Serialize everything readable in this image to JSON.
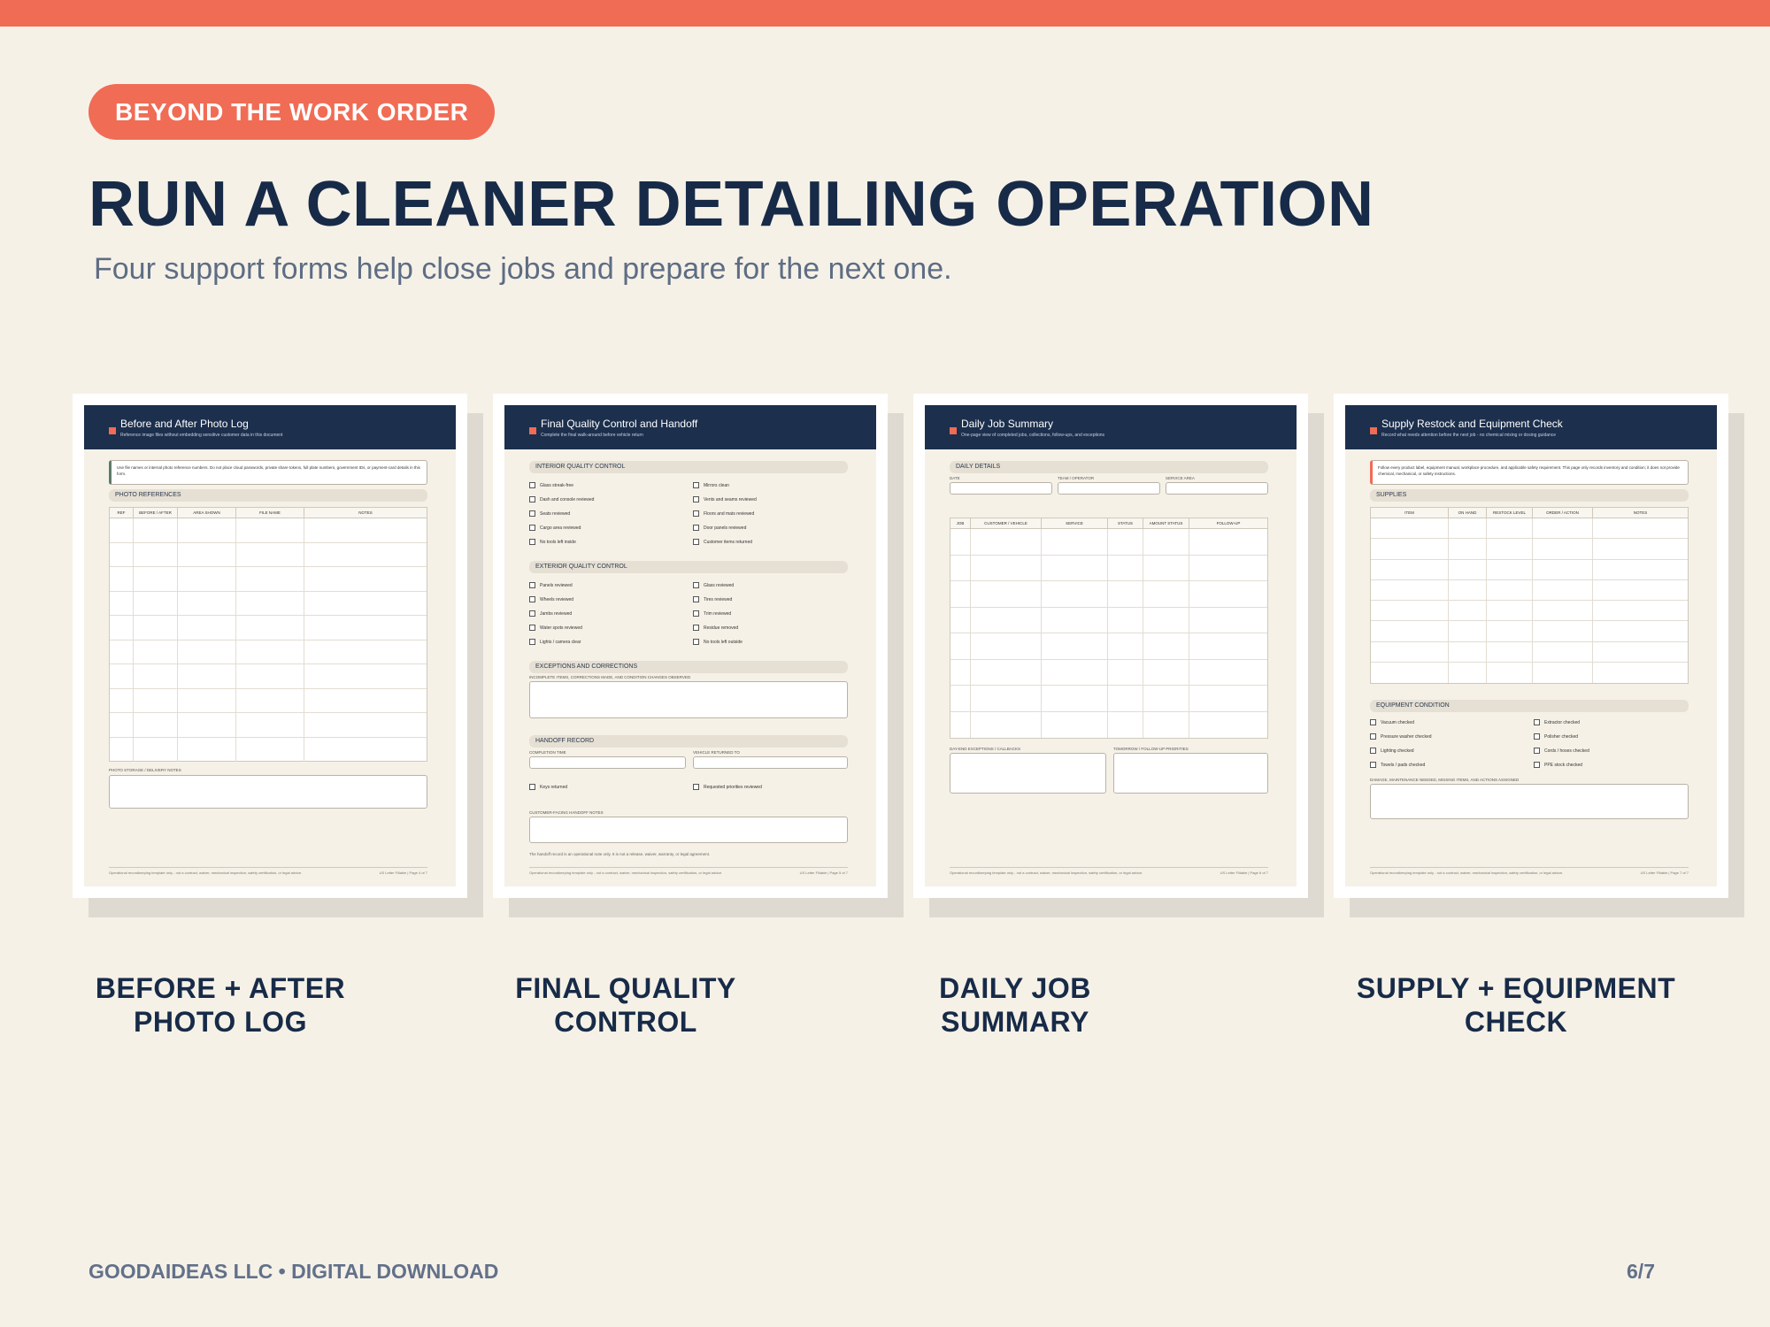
{
  "badge": "BEYOND THE WORK ORDER",
  "title": "RUN A CLEANER DETAILING OPERATION",
  "subtitle": "Four support forms help close jobs and prepare for the next one.",
  "forms": [
    {
      "title": "Before and After Photo Log",
      "subtitle": "Reference image files without embedding sensitive customer data in this document",
      "note": "Use file names or internal photo reference numbers. Do not place cloud passwords, private share tokens, full plate numbers, government IDs, or payment-card details in this form.",
      "section": "PHOTO REFERENCES",
      "columns": [
        "REF",
        "BEFORE / AFTER",
        "AREA SHOWN",
        "FILE NAME",
        "NOTES"
      ],
      "notes_label": "PHOTO STORAGE / DELIVERY NOTES",
      "footer_left": "Operational recordkeeping template only - not a contract, waiver, mechanical inspection, safety certification, or legal advice.",
      "footer_right": "US Letter Fillable | Page 4 of 7",
      "caption": [
        "BEFORE + AFTER",
        "PHOTO LOG"
      ]
    },
    {
      "title": "Final Quality Control and Handoff",
      "subtitle": "Complete the final walk-around before vehicle return",
      "section_interior": "INTERIOR QUALITY CONTROL",
      "interior_left": [
        "Glass streak-free",
        "Dash and console reviewed",
        "Seats reviewed",
        "Cargo area reviewed",
        "No tools left inside"
      ],
      "interior_right": [
        "Mirrors clean",
        "Vents and seams reviewed",
        "Floors and mats reviewed",
        "Door panels reviewed",
        "Customer items returned"
      ],
      "section_exterior": "EXTERIOR QUALITY CONTROL",
      "exterior_left": [
        "Panels reviewed",
        "Wheels reviewed",
        "Jambs reviewed",
        "Water spots reviewed",
        "Lights / camera clear"
      ],
      "exterior_right": [
        "Glass reviewed",
        "Tires reviewed",
        "Trim reviewed",
        "Residue removed",
        "No tools left outside"
      ],
      "section_exceptions": "EXCEPTIONS AND CORRECTIONS",
      "exceptions_label": "INCOMPLETE ITEMS, CORRECTIONS MADE, AND CONDITION CHANGES OBSERVED",
      "section_handoff": "HANDOFF RECORD",
      "completion_label": "COMPLETION TIME",
      "vehicle_label": "VEHICLE RETURNED TO",
      "keys_label": "Keys returned",
      "priorities_label": "Requested priorities reviewed",
      "handoff_notes_label": "CUSTOMER-FACING HANDOFF NOTES",
      "small_note": "The handoff record is an operational note only. It is not a release, waiver, warranty, or legal agreement.",
      "footer_left": "Operational recordkeeping template only - not a contract, waiver, mechanical inspection, safety certification, or legal advice.",
      "footer_right": "US Letter Fillable | Page 5 of 7",
      "caption": [
        "FINAL QUALITY",
        "CONTROL"
      ]
    },
    {
      "title": "Daily Job Summary",
      "subtitle": "One-page view of completed jobs, collections, follow-ups, and exceptions",
      "section": "DAILY DETAILS",
      "date_label": "DATE",
      "team_label": "TEAM / OPERATOR",
      "area_label": "SERVICE AREA",
      "columns": [
        "JOB",
        "CUSTOMER / VEHICLE",
        "SERVICE",
        "STATUS",
        "AMOUNT STATUS",
        "FOLLOW-UP"
      ],
      "exceptions_label": "DAY-END EXCEPTIONS / CALLBACKS",
      "priorities_label": "TOMORROW / FOLLOW-UP PRIORITIES",
      "footer_left": "Operational recordkeeping template only - not a contract, waiver, mechanical inspection, safety certification, or legal advice.",
      "footer_right": "US Letter Fillable | Page 6 of 7",
      "caption": [
        "DAILY JOB",
        "SUMMARY"
      ]
    },
    {
      "title": "Supply Restock and Equipment Check",
      "subtitle": "Record what needs attention before the next job - no chemical mixing or dosing guidance",
      "note": "Follow every product label, equipment manual, workplace procedure, and applicable safety requirement. This page only records inventory and condition; it does not provide chemical, mechanical, or safety instructions.",
      "section": "SUPPLIES",
      "columns": [
        "ITEM",
        "ON HAND",
        "RESTOCK LEVEL",
        "ORDER / ACTION",
        "NOTES"
      ],
      "section_equipment": "EQUIPMENT CONDITION",
      "equip_left": [
        "Vacuum checked",
        "Pressure washer checked",
        "Lighting checked",
        "Towels / pads checked"
      ],
      "equip_right": [
        "Extractor checked",
        "Polisher checked",
        "Cords / hoses checked",
        "PPE stock checked"
      ],
      "damage_label": "DAMAGE, MAINTENANCE NEEDED, MISSING ITEMS, AND ACTIONS ASSIGNED",
      "footer_left": "Operational recordkeeping template only - not a contract, waiver, mechanical inspection, safety certification, or legal advice.",
      "footer_right": "US Letter Fillable | Page 7 of 7",
      "caption": [
        "SUPPLY + EQUIPMENT",
        "CHECK"
      ]
    }
  ],
  "footer": {
    "left": "GOODAIDEAS LLC • DIGITAL DOWNLOAD",
    "page": "6/7"
  }
}
